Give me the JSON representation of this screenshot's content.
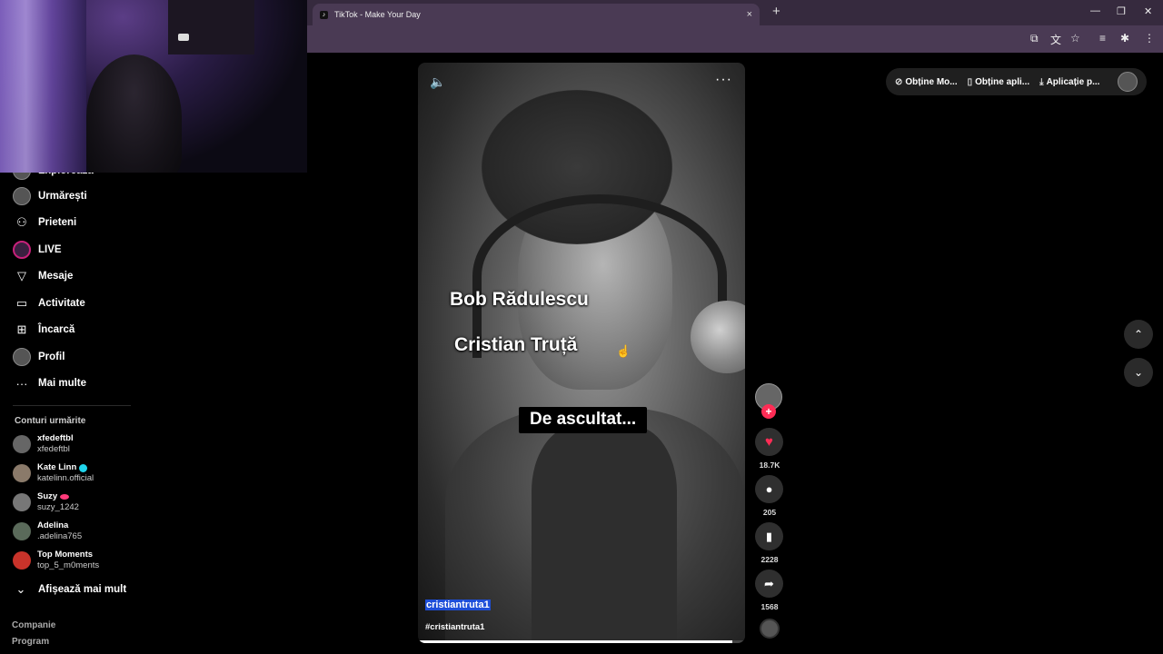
{
  "browser": {
    "tab_title": "TikTok - Make Your Day",
    "tab_favicon": "tiktok-icon",
    "tab_close": "×",
    "new_tab": "+",
    "window": {
      "minimize": "—",
      "restore": "❐",
      "close": "✕"
    }
  },
  "sidebar": {
    "items": [
      {
        "label": "Explorează",
        "icon": "compass-icon",
        "glyph": "◎"
      },
      {
        "label": "Urmărești",
        "icon": "following-avatar-icon",
        "glyph": "●"
      },
      {
        "label": "Prieteni",
        "icon": "friends-icon",
        "glyph": "⚇"
      },
      {
        "label": "LIVE",
        "icon": "live-icon",
        "glyph": "●"
      },
      {
        "label": "Mesaje",
        "icon": "messages-icon",
        "glyph": "▽"
      },
      {
        "label": "Activitate",
        "icon": "activity-icon",
        "glyph": "▭"
      },
      {
        "label": "Încarcă",
        "icon": "upload-icon",
        "glyph": "⊞"
      },
      {
        "label": "Profil",
        "icon": "profile-avatar-icon",
        "glyph": "●"
      },
      {
        "label": "Mai multe",
        "icon": "more-icon",
        "glyph": "···"
      }
    ],
    "followed_heading": "Conturi urmărite",
    "followed_accounts": [
      {
        "name": "xfedeftbl",
        "handle": "xfedeftbl",
        "badge": ""
      },
      {
        "name": "Kate Linn",
        "handle": "katelinn.official",
        "badge": "verified"
      },
      {
        "name": "Suzy",
        "handle": "suzy_1242",
        "badge": "lips"
      },
      {
        "name": "Adelina",
        "handle": ".adelina765",
        "badge": ""
      },
      {
        "name": "Top Moments",
        "handle": "top_5_m0ments",
        "badge": ""
      }
    ],
    "show_more": "Afișează mai mult",
    "show_more_icon": "⌄",
    "footer": [
      "Companie",
      "Program"
    ]
  },
  "video": {
    "overlay_name_1": "Bob Rădulescu",
    "overlay_name_2": "Cristian Truță",
    "overlay_caption": "De ascultat...",
    "author": "cristiantruta1",
    "hashtag": "#cristiantruta1",
    "volume_icon": "🔈",
    "more_icon": "···",
    "progress": 0.96
  },
  "actions": {
    "follow_plus": "+",
    "like_count": "18.7K",
    "comment_count": "205",
    "bookmark_count": "2228",
    "share_count": "1568",
    "like_icon": "♥",
    "comment_icon": "●",
    "bookmark_icon": "▮",
    "share_icon": "➦"
  },
  "topbar": {
    "items": [
      {
        "label": "Obține Mo...",
        "icon": "coin-icon",
        "glyph": "⊘"
      },
      {
        "label": "Obține apli...",
        "icon": "phone-icon",
        "glyph": "▯"
      },
      {
        "label": "Aplicație p...",
        "icon": "download-icon",
        "glyph": "⤓"
      }
    ]
  },
  "nav": {
    "up": "⌃",
    "down": "⌄"
  },
  "colors": {
    "accent": "#fe2c55",
    "verified": "#20d5ec",
    "tab_bg": "#4a3a54",
    "tabbar_bg": "#362a3e"
  }
}
